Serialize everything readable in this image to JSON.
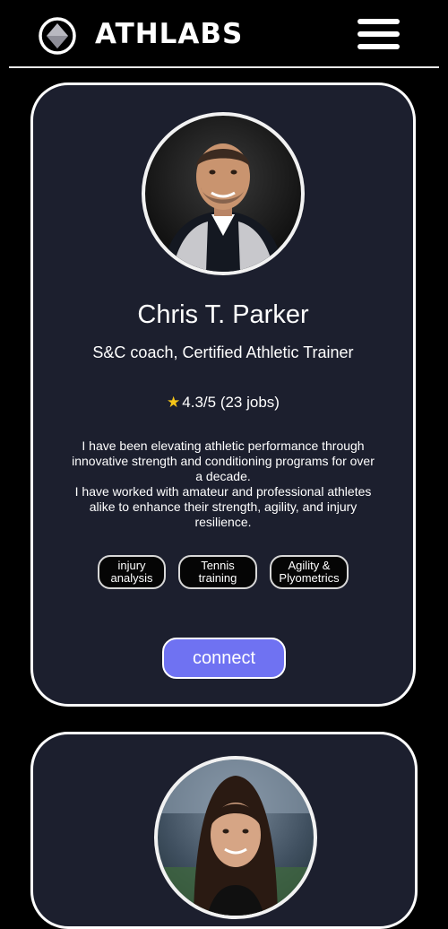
{
  "brand": {
    "name": "ATHLABS",
    "logo_icon": "diamond-circle-icon",
    "menu_icon": "hamburger-menu-icon"
  },
  "colors": {
    "background": "#000000",
    "card": "#1c1f2e",
    "accent": "#6f72f2",
    "star": "#f5c518"
  },
  "coaches": [
    {
      "name": "Chris T. Parker",
      "title": "S&C coach, Certified Athletic Trainer",
      "rating_icon": "star-icon",
      "rating_text": "4.3/5 (23 jobs)",
      "bio": [
        "I have been elevating athletic performance through innovative strength and conditioning programs for over a decade.",
        "I have worked with amateur and professional athletes alike to enhance their strength, agility, and injury resilience."
      ],
      "tags": [
        "injury analysis",
        "Tennis training",
        "Agility & Plyometrics"
      ],
      "action_label": "connect"
    }
  ]
}
